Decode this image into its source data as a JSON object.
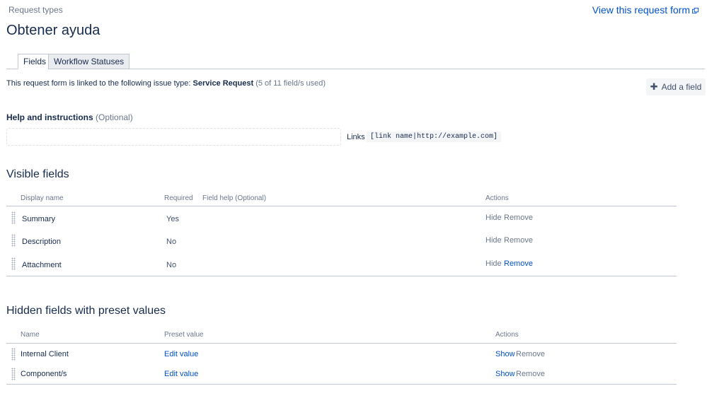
{
  "breadcrumb": "Request types",
  "view_link": "View this request form",
  "title": "Obtener ayuda",
  "tabs": [
    {
      "label": "Fields"
    },
    {
      "label": "Workflow Statuses"
    }
  ],
  "linked": {
    "prefix": "This request form is linked to the following issue type:",
    "issue_type": "Service Request",
    "usage": "(5 of 11 field/s used)"
  },
  "add_field_label": "Add a field",
  "help": {
    "heading": "Help and instructions",
    "optional": "(Optional)",
    "links_label": "Links",
    "links_code": "[link name|http://example.com]"
  },
  "visible_fields": {
    "title": "Visible fields",
    "headers": {
      "display_name": "Display name",
      "required": "Required",
      "field_help": "Field help (Optional)",
      "actions": "Actions"
    },
    "rows": [
      {
        "name": "Summary",
        "required": "Yes",
        "hide": "Hide",
        "remove": "Remove"
      },
      {
        "name": "Description",
        "required": "No",
        "hide": "Hide",
        "remove": "Remove"
      },
      {
        "name": "Attachment",
        "required": "No",
        "hide": "Hide",
        "remove": "Remove"
      }
    ]
  },
  "hidden_fields": {
    "title": "Hidden fields with preset values",
    "headers": {
      "name": "Name",
      "preset": "Preset value",
      "actions": "Actions"
    },
    "rows": [
      {
        "name": "Internal Client",
        "preset": "Edit value",
        "show": "Show",
        "remove": "Remove"
      },
      {
        "name": "Component/s",
        "preset": "Edit value",
        "show": "Show",
        "remove": "Remove"
      }
    ]
  },
  "colors": {
    "link": "#0052cc",
    "text": "#172b4d",
    "muted": "#6b778c"
  }
}
